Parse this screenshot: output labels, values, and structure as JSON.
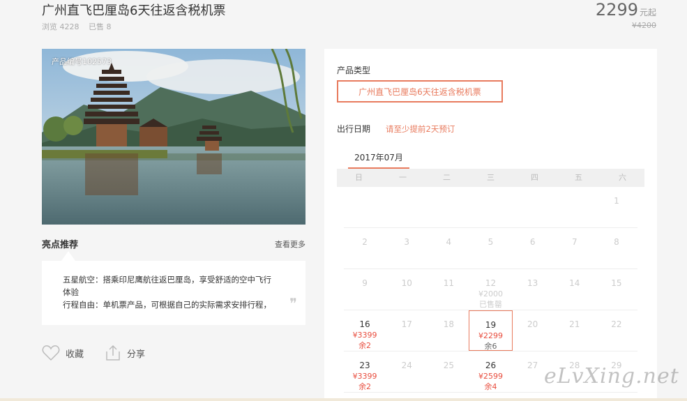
{
  "product": {
    "title": "广州直飞巴厘岛6天往返含税机票",
    "views": "浏览 4228",
    "sold": "已售 8",
    "price": "2299",
    "price_unit": "元起",
    "original_price": "¥4200",
    "product_no": "产品编号102573"
  },
  "highlights": {
    "title": "亮点推荐",
    "more": "查看更多",
    "lines": [
      "五星航空：搭乘印尼鹰航往返巴厘岛，享受舒适的空中飞行",
      "体验",
      "行程自由：单机票产品，可根据自己的实际需求安排行程，"
    ],
    "quote_mark": "❞"
  },
  "actions": {
    "favorite": "收藏",
    "share": "分享"
  },
  "booking": {
    "type_label": "产品类型",
    "type_option": "广州直飞巴厘岛6天往返含税机票",
    "date_label": "出行日期",
    "date_hint": "请至少提前2天预订",
    "month": "2017年07月",
    "weekdays": [
      "日",
      "一",
      "二",
      "三",
      "四",
      "五",
      "六"
    ],
    "weeks": [
      [
        {
          "d": ""
        },
        {
          "d": ""
        },
        {
          "d": ""
        },
        {
          "d": ""
        },
        {
          "d": ""
        },
        {
          "d": ""
        },
        {
          "d": "1"
        }
      ],
      [
        {
          "d": "2"
        },
        {
          "d": "3"
        },
        {
          "d": "4"
        },
        {
          "d": "5"
        },
        {
          "d": "6"
        },
        {
          "d": "7"
        },
        {
          "d": "8"
        }
      ],
      [
        {
          "d": "9"
        },
        {
          "d": "10"
        },
        {
          "d": "11"
        },
        {
          "d": "12",
          "p": "¥2000",
          "r": "已售罄",
          "state": "sold"
        },
        {
          "d": "13"
        },
        {
          "d": "14"
        },
        {
          "d": "15"
        }
      ],
      [
        {
          "d": "16",
          "p": "¥3399",
          "r": "余2",
          "state": "avail"
        },
        {
          "d": "17"
        },
        {
          "d": "18"
        },
        {
          "d": "19",
          "p": "¥2299",
          "r": "余6",
          "state": "sel"
        },
        {
          "d": "20"
        },
        {
          "d": "21"
        },
        {
          "d": "22"
        }
      ],
      [
        {
          "d": "23",
          "p": "¥3399",
          "r": "余2",
          "state": "avail"
        },
        {
          "d": "24"
        },
        {
          "d": "25"
        },
        {
          "d": "26",
          "p": "¥2599",
          "r": "余4",
          "state": "avail"
        },
        {
          "d": "27"
        },
        {
          "d": "28"
        },
        {
          "d": "29"
        }
      ]
    ]
  },
  "watermark": "eLvXing.net",
  "colors": {
    "accent": "#e87a5d",
    "price_red": "#e84c3d"
  }
}
